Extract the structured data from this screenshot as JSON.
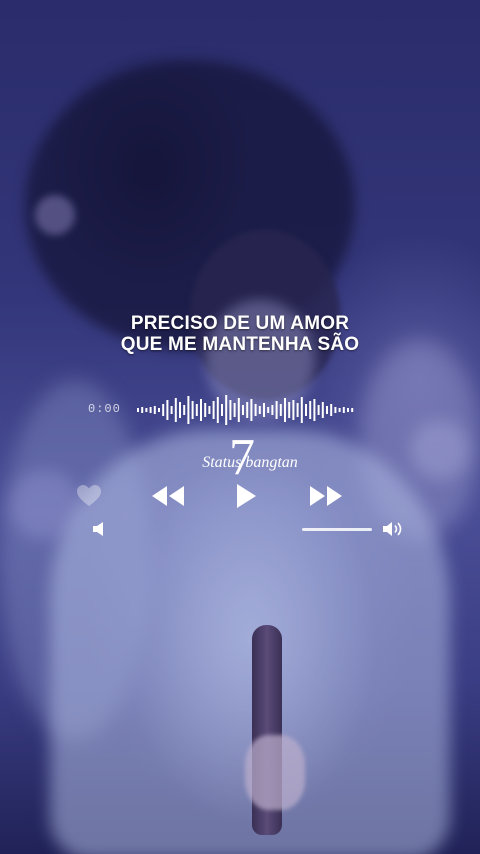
{
  "lyrics": {
    "line1": "PRECISO DE UM AMOR",
    "line2": "QUE ME MANTENHA SÃO"
  },
  "player": {
    "time": "0:00",
    "progress": 0,
    "controls": {
      "like_icon": "heart-icon",
      "previous_icon": "rewind-icon",
      "play_icon": "play-icon",
      "next_icon": "fast-forward-icon",
      "volume_low_icon": "speaker-low-icon",
      "volume_high_icon": "speaker-high-icon"
    },
    "volume_level": 1
  },
  "watermark": {
    "number": "7",
    "text": "Status bangtan"
  },
  "colors": {
    "accent": "#ffffff",
    "background": "#33367a"
  }
}
